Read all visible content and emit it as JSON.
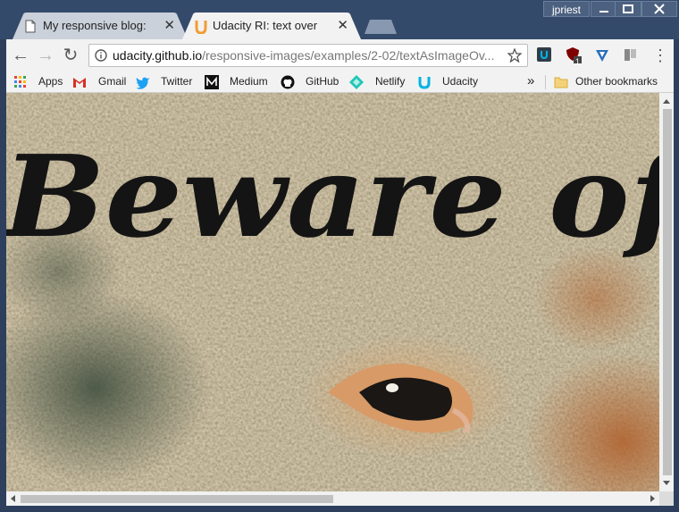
{
  "window": {
    "user_label": "jpriest",
    "minimize_symbol": "—",
    "maximize_symbol": "☐",
    "close_symbol": "✕"
  },
  "tabs": [
    {
      "label": "My responsive blog: pictu",
      "close": "✕",
      "icon": "document-icon",
      "active": false
    },
    {
      "label": "Udacity RI: text over imag",
      "close": "✕",
      "icon": "udacity-u-icon",
      "active": true
    }
  ],
  "toolbar": {
    "back": "←",
    "forward": "→",
    "reload": "↻",
    "url_host": "udacity.github.io",
    "url_path": "/responsive-images/examples/2-02/textAsImageOv...",
    "extensions": [
      "udacity-extension-icon",
      "ublock-icon",
      "vpn-icon",
      "reading-list-icon"
    ],
    "ublock_badge": "1",
    "menu": "⋮"
  },
  "bookmarks": [
    {
      "label": "Apps",
      "icon": "apps-grid-icon"
    },
    {
      "label": "Gmail",
      "icon": "gmail-icon"
    },
    {
      "label": "Twitter",
      "icon": "twitter-icon"
    },
    {
      "label": "Medium",
      "icon": "medium-icon"
    },
    {
      "label": "GitHub",
      "icon": "github-icon"
    },
    {
      "label": "Netlify",
      "icon": "netlify-icon"
    },
    {
      "label": "Udacity",
      "icon": "udacity-icon"
    }
  ],
  "bookmarks_overflow": "»",
  "other_bookmarks": "Other bookmarks",
  "page": {
    "image_text": "Beware of"
  },
  "colors": {
    "frame": "#2d3f5c",
    "toolbar": "#f2f2f2",
    "udacity_orange": "#f39c31",
    "udacity_blue": "#02b3e4"
  }
}
